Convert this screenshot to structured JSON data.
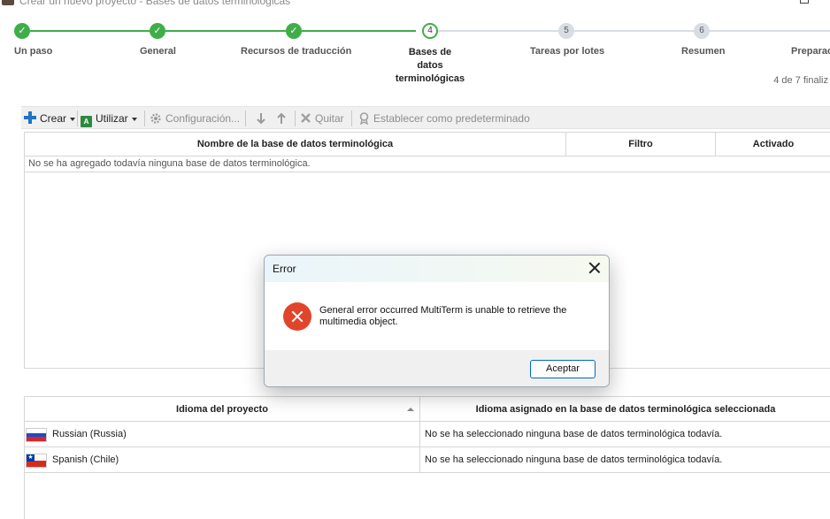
{
  "window": {
    "title": "Crear un nuevo proyecto - Bases de datos terminológicas"
  },
  "steps": [
    {
      "num": "✓",
      "label": "Un paso",
      "state": "done"
    },
    {
      "num": "✓",
      "label": "General",
      "state": "done"
    },
    {
      "num": "✓",
      "label": "Recursos de traducción",
      "state": "done"
    },
    {
      "num": "4",
      "label": "Bases de datos terminológicas",
      "state": "current"
    },
    {
      "num": "5",
      "label": "Tareas por lotes",
      "state": "future"
    },
    {
      "num": "6",
      "label": "Resumen",
      "state": "future"
    },
    {
      "num": "",
      "label": "Preparac",
      "state": "future"
    }
  ],
  "progress_text": "4 de 7 finaliz",
  "toolbar": {
    "create": "Crear",
    "use": "Utilizar",
    "settings": "Configuración...",
    "remove": "Quitar",
    "set_default": "Establecer como predeterminado"
  },
  "termbase_grid": {
    "columns": [
      "Nombre de la base de datos terminológica",
      "Filtro",
      "Activado"
    ],
    "empty_message": "No se ha agregado todavía ninguna base de datos terminológica."
  },
  "language_grid": {
    "columns": [
      "Idioma del proyecto",
      "Idioma asignado en la base de datos terminológica seleccionada"
    ],
    "rows": [
      {
        "language": "Russian (Russia)",
        "assigned": "No se ha seleccionado ninguna base de datos terminológica todavía.",
        "flag": "russia-flag"
      },
      {
        "language": "Spanish (Chile)",
        "assigned": "No se ha seleccionado ninguna base de datos terminológica todavía.",
        "flag": "chile-flag"
      }
    ]
  },
  "dialog": {
    "title": "Error",
    "message": "General error occurred MultiTerm is unable to retrieve the multimedia object.",
    "ok_label": "Aceptar",
    "icon": "error-icon"
  },
  "colors": {
    "step_done": "#3fae49",
    "error_icon": "#e0452b",
    "button_border": "#0067c0"
  }
}
